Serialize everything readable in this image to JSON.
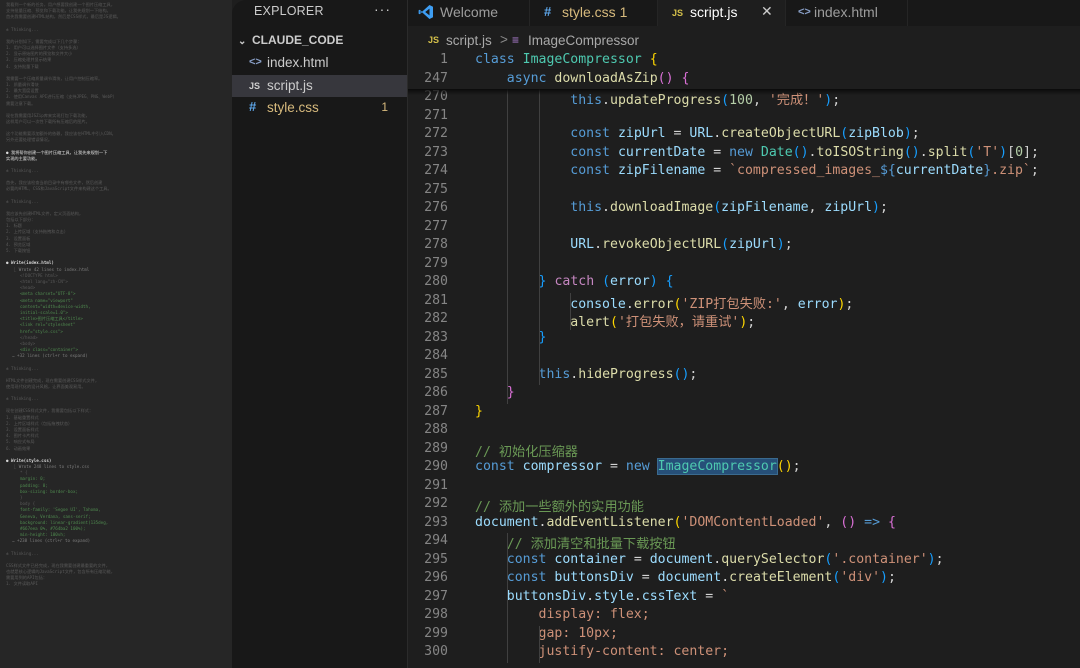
{
  "log_panel": {
    "lines": [
      {
        "t": "think",
        "x": "我看到一个新的任务，用户想要我创建一个图片压缩工具，"
      },
      {
        "t": "think",
        "x": "支持批量压缩、预览和下载功能。让我先规划一下结构。"
      },
      {
        "t": "think",
        "x": "首先我需要创建HTML结构，然后是CSS样式，最后是JS逻辑。"
      },
      {
        "t": "gap"
      },
      {
        "t": "think",
        "x": "✻ Thinking..."
      },
      {
        "t": "gap"
      },
      {
        "t": "t",
        "x": "我的计划如下，需要完成以下几个步骤："
      },
      {
        "t": "t",
        "x": "1. 用户可以选择图片文件（支持多选）"
      },
      {
        "t": "t",
        "x": "2. 显示原始图片的预览和文件大小"
      },
      {
        "t": "t",
        "x": "3. 压缩处理并显示结果"
      },
      {
        "t": "t",
        "x": "4. 支持批量下载"
      },
      {
        "t": "gap"
      },
      {
        "t": "t",
        "x": "我需要一个压缩质量调节滑块，让用户控制压缩率。"
      },
      {
        "t": "t",
        "x": "1. 质量调节滑块"
      },
      {
        "t": "t",
        "x": "2. 最大宽度设置"
      },
      {
        "t": "t",
        "x": "3. 使用Canvas API进行压缩（支持JPEG、PNG、WebP）"
      },
      {
        "t": "t",
        "x": "需要注意下载。"
      },
      {
        "t": "gap"
      },
      {
        "t": "t",
        "x": "现在我需要用JSZip库来实现打包下载功能，"
      },
      {
        "t": "t",
        "x": "这样用户可以一次性下载所有压缩后的图片。"
      },
      {
        "t": "gap"
      },
      {
        "t": "t",
        "x": "这个功能需要添加额外的依赖，我应该在HTML中引入CDN。"
      },
      {
        "t": "t",
        "x": "另外还要处理错误情况。"
      },
      {
        "t": "gap"
      },
      {
        "t": "hl",
        "x": "● 我将帮你创建一个图片压缩工具，让我先来规划一下"
      },
      {
        "t": "hl",
        "x": "  实现的主要功能。"
      },
      {
        "t": "gap"
      },
      {
        "t": "think",
        "x": "✻ Thinking..."
      },
      {
        "t": "gap"
      },
      {
        "t": "t",
        "x": "首先，我应该检查当前目录中有哪些文件，然后创建"
      },
      {
        "t": "t",
        "x": "必要的HTML、CSS和JavaScript文件来构建这个工具。"
      },
      {
        "t": "gap"
      },
      {
        "t": "think",
        "x": "✻ Thinking..."
      },
      {
        "t": "gap"
      },
      {
        "t": "t",
        "x": "我应该先创建HTML文件，定义页面结构，"
      },
      {
        "t": "t",
        "x": "包括以下部分："
      },
      {
        "t": "t",
        "x": "1. 标题"
      },
      {
        "t": "t",
        "x": "2. 上传区域（支持拖拽和点击）"
      },
      {
        "t": "t",
        "x": "3. 设置面板"
      },
      {
        "t": "t",
        "x": "4. 预览区域"
      },
      {
        "t": "t",
        "x": "5. 下载按钮"
      },
      {
        "t": "gap"
      },
      {
        "t": "h",
        "x": "● Write(index.html)"
      },
      {
        "t": "r",
        "x": "⎿ Wrote 42 lines to index.html"
      },
      {
        "t": "cd",
        "x": "<!DOCTYPE html>"
      },
      {
        "t": "cd",
        "x": "<html lang=\"zh-CN\">"
      },
      {
        "t": "cd",
        "x": "<head>"
      },
      {
        "t": "c",
        "x": "  <meta charset=\"UTF-8\">"
      },
      {
        "t": "c",
        "x": "  <meta name=\"viewport\""
      },
      {
        "t": "c",
        "x": "content=\"width=device-width,"
      },
      {
        "t": "c",
        "x": "initial-scale=1.0\">"
      },
      {
        "t": "c",
        "x": "  <title>图片压缩工具</title>"
      },
      {
        "t": "c",
        "x": "  <link rel=\"stylesheet\""
      },
      {
        "t": "c",
        "x": "href=\"style.css\">"
      },
      {
        "t": "cd",
        "x": "</head>"
      },
      {
        "t": "cd",
        "x": "<body>"
      },
      {
        "t": "c",
        "x": "  <div class=\"container\">"
      },
      {
        "t": "r",
        "x": "… +32 lines (ctrl+r to expand)"
      },
      {
        "t": "gap"
      },
      {
        "t": "think",
        "x": "✻ Thinking..."
      },
      {
        "t": "gap"
      },
      {
        "t": "t",
        "x": "HTML文件创建完成，现在需要创建CSS样式文件，"
      },
      {
        "t": "t",
        "x": "使用现代化的设计风格，让界面美观易用。"
      },
      {
        "t": "gap"
      },
      {
        "t": "think",
        "x": "✻ Thinking..."
      },
      {
        "t": "gap"
      },
      {
        "t": "t",
        "x": "现在创建CSS样式文件，我需要包括以下样式："
      },
      {
        "t": "t",
        "x": "1. 基础重置样式"
      },
      {
        "t": "t",
        "x": "2. 上传区域样式（包括拖拽状态）"
      },
      {
        "t": "t",
        "x": "3. 设置面板样式"
      },
      {
        "t": "t",
        "x": "4. 图片卡片样式"
      },
      {
        "t": "t",
        "x": "5. 响应式布局"
      },
      {
        "t": "t",
        "x": "6. 动画效果"
      },
      {
        "t": "gap"
      },
      {
        "t": "h",
        "x": "● Write(style.css)"
      },
      {
        "t": "r",
        "x": "⎿ Wrote 248 lines to style.css"
      },
      {
        "t": "cd",
        "x": "* {"
      },
      {
        "t": "c",
        "x": "    margin: 0;"
      },
      {
        "t": "c",
        "x": "    padding: 0;"
      },
      {
        "t": "c",
        "x": "    box-sizing: border-box;"
      },
      {
        "t": "cd",
        "x": "}"
      },
      {
        "t": "cd",
        "x": "body {"
      },
      {
        "t": "c",
        "x": "    font-family: 'Segoe UI', Tahoma,"
      },
      {
        "t": "c",
        "x": "Geneva, Verdana, sans-serif;"
      },
      {
        "t": "c",
        "x": "    background: linear-gradient(135deg,"
      },
      {
        "t": "c",
        "x": "#667eea 0%, #764ba2 100%);"
      },
      {
        "t": "c",
        "x": "    min-height: 100vh;"
      },
      {
        "t": "r",
        "x": "… +238 lines (ctrl+r to expand)"
      },
      {
        "t": "gap"
      },
      {
        "t": "think",
        "x": "✻ Thinking..."
      },
      {
        "t": "gap"
      },
      {
        "t": "t",
        "x": "CSS样式文件已经完成，现在我需要创建最重要的文件，"
      },
      {
        "t": "t",
        "x": "也就是核心逻辑的JavaScript文件，包含所有压缩功能，"
      },
      {
        "t": "t",
        "x": "需要用到的API包括："
      },
      {
        "t": "t",
        "x": "1. 文件读取API"
      }
    ]
  },
  "explorer": {
    "title": "EXPLORER",
    "more": "···",
    "folder": "CLAUDE_CODE",
    "files": [
      {
        "name": "index.html",
        "icon": "<>",
        "kind": "html",
        "active": false,
        "badge": ""
      },
      {
        "name": "script.js",
        "icon": "JS",
        "kind": "js",
        "active": true,
        "badge": ""
      },
      {
        "name": "style.css",
        "icon": "#",
        "kind": "css",
        "active": false,
        "badge": "1"
      }
    ]
  },
  "tabs": [
    {
      "label": "Welcome",
      "active": false
    },
    {
      "label": "style.css 1",
      "active": false
    },
    {
      "label": "script.js",
      "active": true
    },
    {
      "label": "index.html",
      "active": false
    }
  ],
  "breadcrumb": {
    "file": "script.js",
    "separator": ">",
    "symbol": "ImageCompressor"
  },
  "editor": {
    "lines": [
      {
        "n": "1",
        "sticky": true,
        "html": "<span class=\"kw\">class</span> <span class=\"ty\">ImageCompressor</span> <span class=\"b1\">{</span>"
      },
      {
        "n": "247",
        "sticky": true,
        "html": "    <span class=\"kw\">async</span> <span class=\"fn\">downloadAsZip</span><span class=\"b2\">()</span> <span class=\"b2\">{</span>"
      },
      {
        "n": "270",
        "html": "            <span class=\"kw\">this</span>.<span class=\"fn\">updateProgress</span><span class=\"b3\">(</span><span class=\"nm\">100</span>, <span class=\"st\">'完成！'</span><span class=\"b3\">)</span>;"
      },
      {
        "n": "271",
        "html": ""
      },
      {
        "n": "272",
        "html": "            <span class=\"kw\">const</span> <span class=\"vr\">zipUrl</span> = <span class=\"vr\">URL</span>.<span class=\"fn\">createObjectURL</span><span class=\"b3\">(</span><span class=\"vr\">zipBlob</span><span class=\"b3\">)</span>;"
      },
      {
        "n": "273",
        "html": "            <span class=\"kw\">const</span> <span class=\"vr\">currentDate</span> = <span class=\"kw\">new</span> <span class=\"ty\">Date</span><span class=\"b3\">()</span>.<span class=\"fn\">toISOString</span><span class=\"b3\">()</span>.<span class=\"fn\">split</span><span class=\"b3\">(</span><span class=\"st\">'T'</span><span class=\"b3\">)</span>[<span class=\"nm\">0</span>];"
      },
      {
        "n": "274",
        "html": "            <span class=\"kw\">const</span> <span class=\"vr\">zipFilename</span> = <span class=\"st\">`compressed_images_</span><span class=\"kw\">${</span><span class=\"vr\">currentDate</span><span class=\"kw\">}</span><span class=\"st\">.zip`</span>;"
      },
      {
        "n": "275",
        "html": ""
      },
      {
        "n": "276",
        "html": "            <span class=\"kw\">this</span>.<span class=\"fn\">downloadImage</span><span class=\"b3\">(</span><span class=\"vr\">zipFilename</span>, <span class=\"vr\">zipUrl</span><span class=\"b3\">)</span>;"
      },
      {
        "n": "277",
        "html": ""
      },
      {
        "n": "278",
        "html": "            <span class=\"vr\">URL</span>.<span class=\"fn\">revokeObjectURL</span><span class=\"b3\">(</span><span class=\"vr\">zipUrl</span><span class=\"b3\">)</span>;"
      },
      {
        "n": "279",
        "html": ""
      },
      {
        "n": "280",
        "html": "        <span class=\"b3\">}</span> <span class=\"ctl\">catch</span> <span class=\"b3\">(</span><span class=\"vr\">error</span><span class=\"b3\">)</span> <span class=\"b3\">{</span>"
      },
      {
        "n": "281",
        "html": "            <span class=\"vr\">console</span>.<span class=\"fn\">error</span><span class=\"b1\">(</span><span class=\"st\">'ZIP打包失败:'</span>, <span class=\"vr\">error</span><span class=\"b1\">)</span>;"
      },
      {
        "n": "282",
        "html": "            <span class=\"fn\">alert</span><span class=\"b1\">(</span><span class=\"st\">'打包失败，请重试'</span><span class=\"b1\">)</span>;"
      },
      {
        "n": "283",
        "html": "        <span class=\"b3\">}</span>"
      },
      {
        "n": "284",
        "html": ""
      },
      {
        "n": "285",
        "html": "        <span class=\"kw\">this</span>.<span class=\"fn\">hideProgress</span><span class=\"b3\">()</span>;"
      },
      {
        "n": "286",
        "html": "    <span class=\"b2\">}</span>"
      },
      {
        "n": "287",
        "html": "<span class=\"b1\">}</span>"
      },
      {
        "n": "288",
        "html": ""
      },
      {
        "n": "289",
        "html": "<span class=\"cm\">// 初始化压缩器</span>"
      },
      {
        "n": "290",
        "html": "<span class=\"kw\">const</span> <span class=\"vr\">compressor</span> = <span class=\"kw\">new</span> <span class=\"ty hlw\">ImageCompressor</span><span class=\"b1\">()</span>;"
      },
      {
        "n": "291",
        "html": ""
      },
      {
        "n": "292",
        "html": "<span class=\"cm\">// 添加一些额外的实用功能</span>"
      },
      {
        "n": "293",
        "html": "<span class=\"vr\">document</span>.<span class=\"fn\">addEventListener</span><span class=\"b1\">(</span><span class=\"st\">'DOMContentLoaded'</span>, <span class=\"b2\">()</span> <span class=\"kw\">=&gt;</span> <span class=\"b2\">{</span>"
      },
      {
        "n": "294",
        "html": "    <span class=\"cm\">// 添加清空和批量下载按钮</span>"
      },
      {
        "n": "295",
        "html": "    <span class=\"kw\">const</span> <span class=\"vr\">container</span> = <span class=\"vr\">document</span>.<span class=\"fn\">querySelector</span><span class=\"b3\">(</span><span class=\"st\">'.container'</span><span class=\"b3\">)</span>;"
      },
      {
        "n": "296",
        "html": "    <span class=\"kw\">const</span> <span class=\"vr\">buttonsDiv</span> = <span class=\"vr\">document</span>.<span class=\"fn\">createElement</span><span class=\"b3\">(</span><span class=\"st\">'div'</span><span class=\"b3\">)</span>;"
      },
      {
        "n": "297",
        "html": "    <span class=\"vr\">buttonsDiv</span>.<span class=\"vr\">style</span>.<span class=\"vr\">cssText</span> = <span class=\"st\">`</span>"
      },
      {
        "n": "298",
        "html": "<span class=\"st\">        display: flex;</span>"
      },
      {
        "n": "299",
        "html": "<span class=\"st\">        gap: 10px;</span>"
      },
      {
        "n": "300",
        "html": "<span class=\"st\">        justify-content: center;</span>"
      }
    ]
  }
}
